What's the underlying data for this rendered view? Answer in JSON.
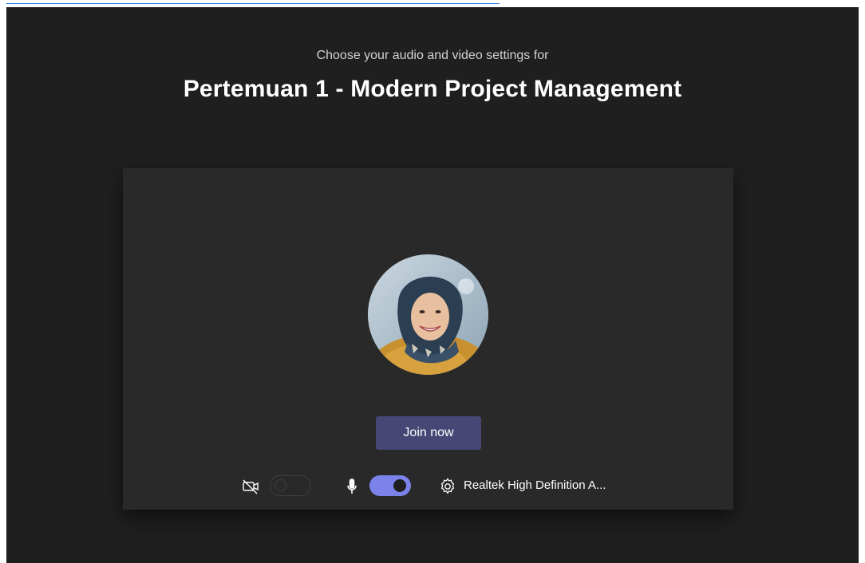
{
  "prejoin": {
    "subtitle": "Choose your audio and video settings for",
    "meeting_title": "Pertemuan 1 - Modern Project Management",
    "join_label": "Join now"
  },
  "controls": {
    "camera": {
      "icon": "camera-off-icon",
      "enabled": false
    },
    "microphone": {
      "icon": "microphone-icon",
      "enabled": true
    },
    "settings": {
      "icon": "gear-icon"
    },
    "audio_device_label": "Realtek High Definition A..."
  },
  "colors": {
    "background": "#1f1f1f",
    "card": "#292929",
    "join_button": "#464775",
    "toggle_on": "#7b83eb"
  }
}
